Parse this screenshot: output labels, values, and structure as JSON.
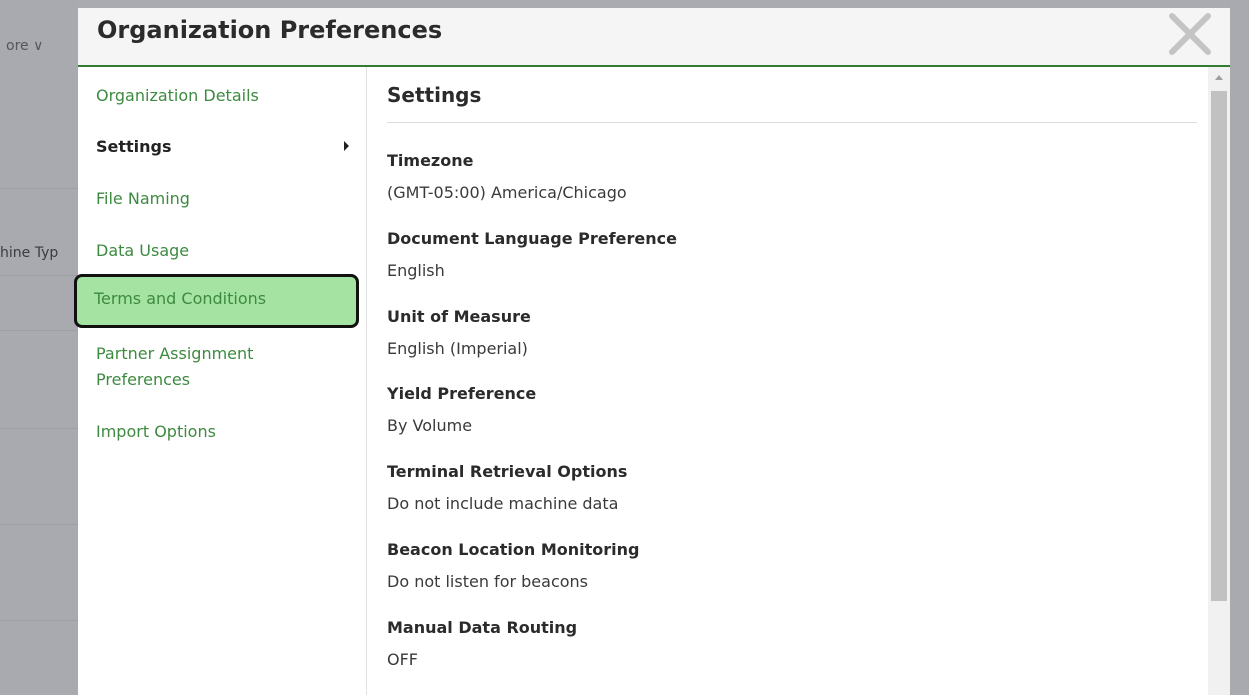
{
  "background": {
    "more_label": "ore ∨",
    "column_header": "hine Typ"
  },
  "modal": {
    "title": "Organization Preferences",
    "close_icon": "close-x-icon"
  },
  "sidebar": {
    "items": [
      {
        "label": "Organization Details"
      },
      {
        "label": "Settings",
        "active": true
      },
      {
        "label": "File Naming"
      },
      {
        "label": "Data Usage"
      },
      {
        "label": "Terms and Conditions",
        "highlighted": true
      },
      {
        "label": "Partner Assignment Preferences"
      },
      {
        "label": "Import Options"
      }
    ]
  },
  "content": {
    "title": "Settings",
    "fields": [
      {
        "label": "Timezone",
        "value": "(GMT-05:00) America/Chicago"
      },
      {
        "label": "Document Language Preference",
        "value": "English"
      },
      {
        "label": "Unit of Measure",
        "value": "English (Imperial)"
      },
      {
        "label": "Yield Preference",
        "value": "By Volume"
      },
      {
        "label": "Terminal Retrieval Options",
        "value": "Do not include machine data"
      },
      {
        "label": "Beacon Location Monitoring",
        "value": "Do not listen for beacons"
      },
      {
        "label": "Manual Data Routing",
        "value": "OFF"
      }
    ]
  },
  "colors": {
    "accent": "#3d8a40",
    "highlight": "#a5e3a2",
    "header_rule": "#2f7d32"
  }
}
